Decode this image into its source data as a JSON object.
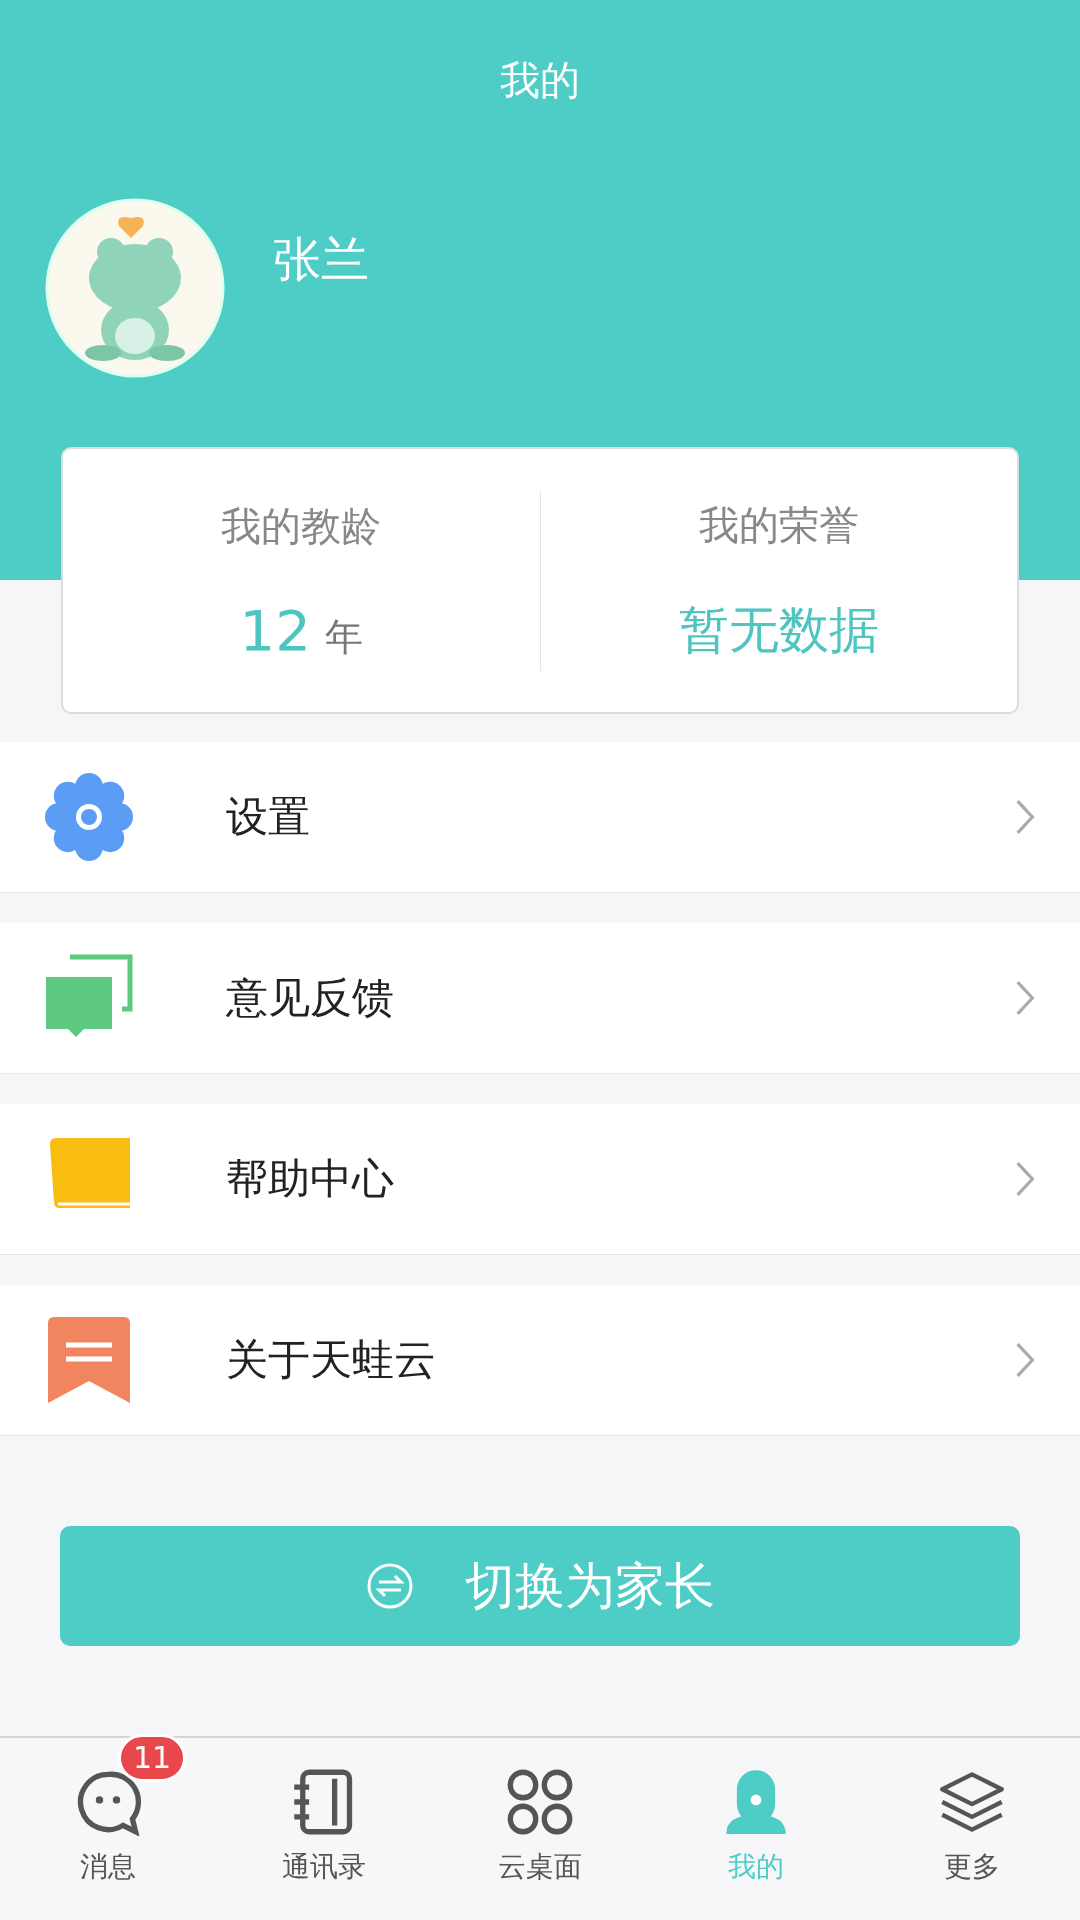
{
  "header": {
    "title": "我的"
  },
  "profile": {
    "name": "张兰"
  },
  "stats": [
    {
      "label": "我的教龄",
      "value": "12",
      "unit": "年"
    },
    {
      "label": "我的荣誉",
      "value": "暂无数据"
    }
  ],
  "menu": [
    {
      "kind": "gear",
      "label": "设置"
    },
    {
      "kind": "feedback",
      "label": "意见反馈"
    },
    {
      "kind": "book",
      "label": "帮助中心"
    },
    {
      "kind": "bookmark",
      "label": "关于天蛙云"
    }
  ],
  "switch_button": {
    "label": "切换为家长"
  },
  "bottom_nav": [
    {
      "kind": "chat",
      "label": "消息",
      "badge": "11",
      "selected": false
    },
    {
      "kind": "contacts",
      "label": "通讯录",
      "selected": false
    },
    {
      "kind": "grid",
      "label": "云桌面",
      "selected": false
    },
    {
      "kind": "person",
      "label": "我的",
      "selected": true
    },
    {
      "kind": "layers",
      "label": "更多",
      "selected": false
    }
  ]
}
